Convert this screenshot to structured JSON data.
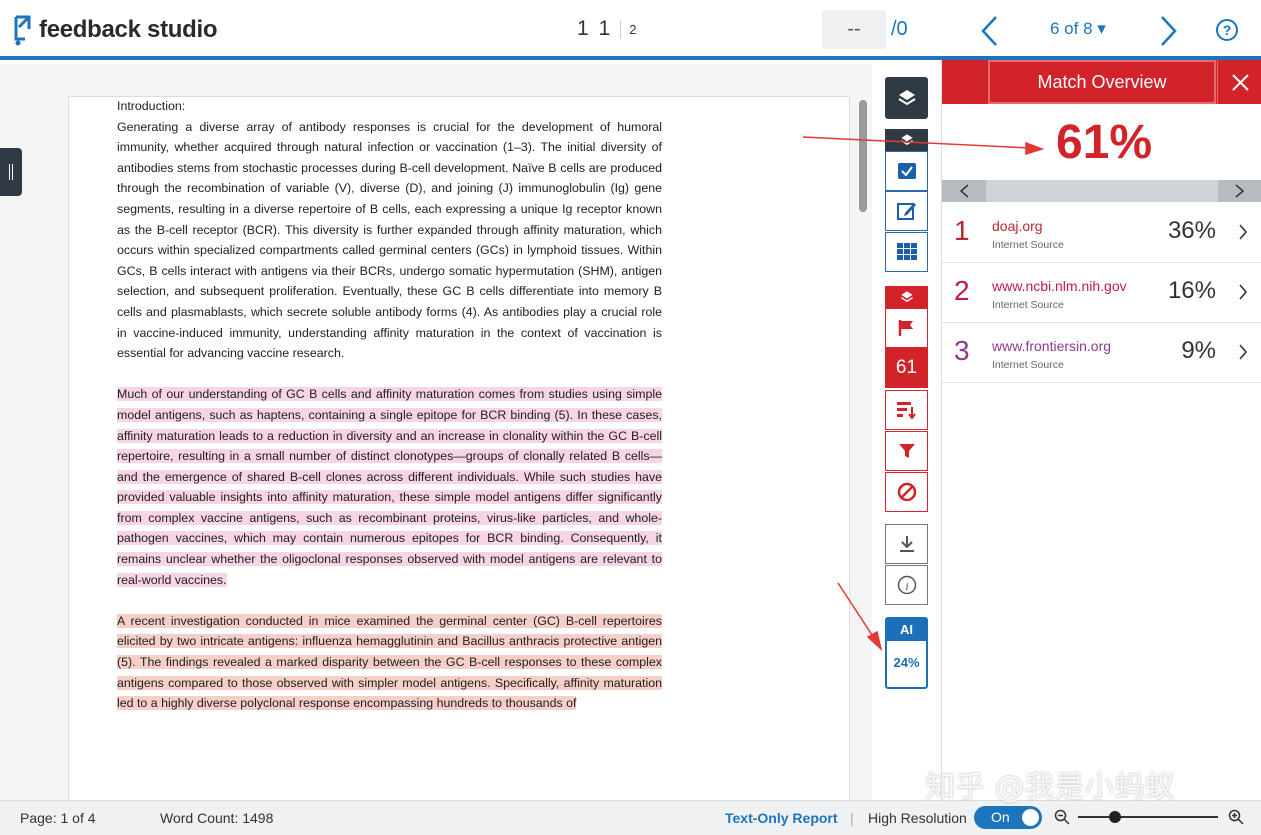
{
  "header": {
    "logo_text": "feedback studio",
    "page_current": "1 1",
    "page_total": "2",
    "grade_value": "--",
    "grade_max": "/0",
    "submission_nav": "6 of 8 ▾",
    "help_label": "?"
  },
  "document": {
    "p1": {
      "heading": "Introduction:",
      "text": "Generating a diverse array of antibody responses is crucial for the development of humoral immunity, whether acquired through natural infection or vaccination (1–3). The initial diversity of antibodies stems from stochastic processes during B-cell development. Naïve B cells are produced through the recombination of variable (V), diverse (D), and joining (J) immunoglobulin (Ig) gene segments, resulting in a diverse repertoire of B cells, each expressing a unique Ig receptor known as the B-cell receptor (BCR). This diversity is further expanded through affinity maturation, which occurs within specialized compartments called germinal centers (GCs) in lymphoid tissues. Within GCs, B cells interact with antigens via their BCRs, undergo somatic hypermutation (SHM), antigen selection, and subsequent proliferation. Eventually, these GC B cells differentiate into memory B cells and plasmablasts, which secrete soluble antibody forms (4). As antibodies play a crucial role in vaccine-induced immunity, understanding affinity maturation in the context of vaccination is essential for advancing vaccine research."
    },
    "p2": "Much of our understanding of GC B cells and affinity maturation comes from studies using simple model antigens, such as haptens, containing a single epitope for BCR binding (5). In these cases, affinity maturation leads to a reduction in diversity and an increase in clonality within the GC B-cell repertoire, resulting in a small number of distinct clonotypes—groups of clonally related B cells—and the emergence of shared B-cell clones across different individuals. While such studies have provided valuable insights into affinity maturation, these simple model antigens differ significantly from complex vaccine antigens, such as recombinant proteins, virus-like particles, and whole-pathogen vaccines, which may contain numerous epitopes for BCR binding. Consequently, it remains unclear whether the oligoclonal responses observed with model antigens are relevant to real-world vaccines.",
    "p3": "A recent investigation conducted in mice examined the germinal center (GC) B-cell repertoires elicited by two intricate antigens: influenza hemagglutinin and Bacillus anthracis protective antigen (5). The findings revealed a marked disparity between the GC B-cell responses to these complex antigens compared to those observed with simpler model antigens. Specifically, affinity maturation led to a highly diverse polyclonal response encompassing hundreds to thousands of"
  },
  "toolbar": {
    "score": "61",
    "ai_label": "AI",
    "ai_pct": "24%"
  },
  "panel": {
    "title": "Match Overview",
    "overall_pct": "61%",
    "sources": [
      {
        "num": "1",
        "name": "doaj.org",
        "kind": "Internet Source",
        "pct": "36%",
        "color": "#c0272d"
      },
      {
        "num": "2",
        "name": "www.ncbi.nlm.nih.gov",
        "kind": "Internet Source",
        "pct": "16%",
        "color": "#c2185b"
      },
      {
        "num": "3",
        "name": "www.frontiersin.org",
        "kind": "Internet Source",
        "pct": "9%",
        "color": "#8e3a8e"
      }
    ]
  },
  "footer": {
    "page": "Page: 1 of 4",
    "word_count": "Word Count: 1498",
    "text_only": "Text-Only Report",
    "high_res": "High Resolution",
    "toggle": "On"
  },
  "watermark": "知乎 @我是小蚂蚁"
}
